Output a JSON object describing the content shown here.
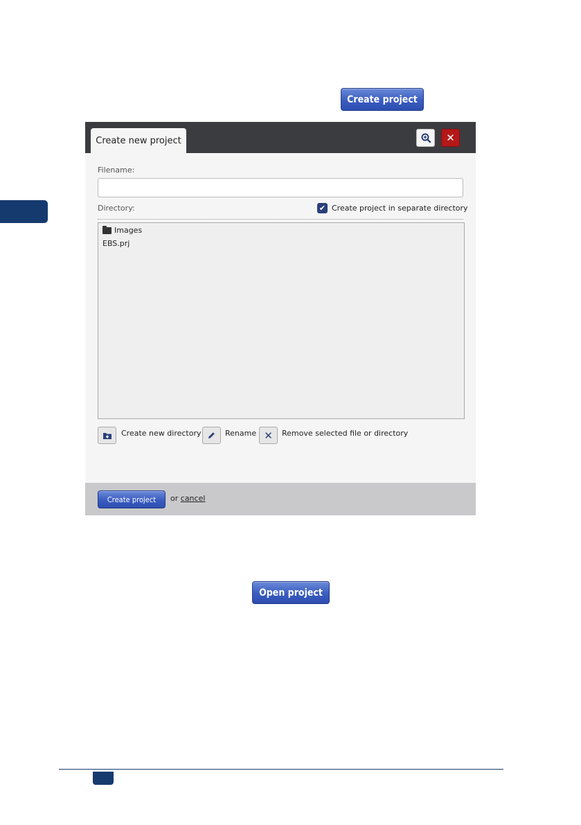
{
  "top_button": {
    "label": "Create project"
  },
  "dialog": {
    "tab_title": "Create new project",
    "filename_label": "Filename:",
    "filename_value": "",
    "directory_label": "Directory:",
    "separate_dir_checkbox": {
      "label": "Create project in separate directory",
      "checked": true
    },
    "files": [
      {
        "name": "Images",
        "type": "folder"
      },
      {
        "name": "EBS.prj",
        "type": "file"
      }
    ],
    "tools": {
      "new_dir": "Create new directory",
      "rename": "Rename",
      "remove": "Remove selected file or directory"
    },
    "footer": {
      "create_label": "Create project",
      "or": "or",
      "cancel": "cancel"
    }
  },
  "open_button": {
    "label": "Open project"
  },
  "colors": {
    "accent": "#3a5cc0",
    "navy": "#153a6e",
    "danger": "#b41818",
    "header": "#3b3c40"
  },
  "icons": [
    "zoom-icon",
    "close-icon",
    "check-icon",
    "folder-icon",
    "new-folder-icon",
    "pencil-icon",
    "x-icon"
  ]
}
